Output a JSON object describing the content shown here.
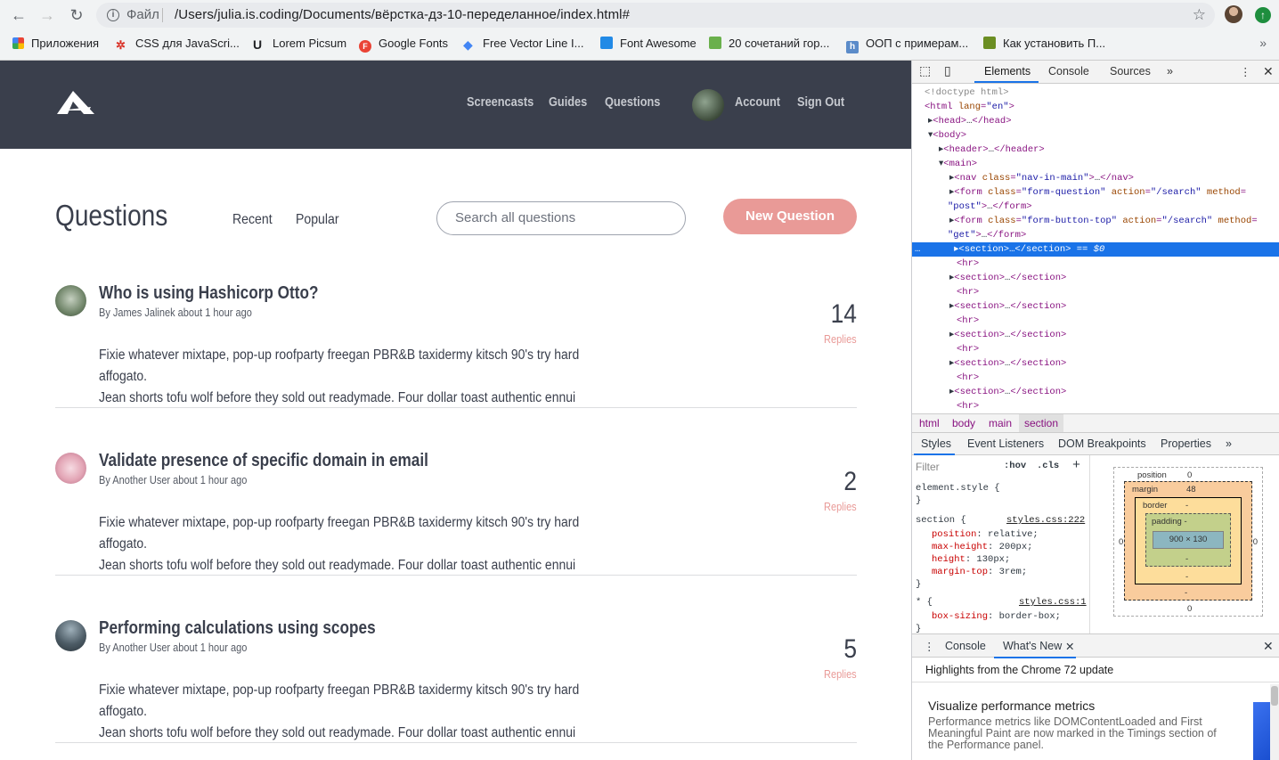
{
  "browser": {
    "file_label": "Файл",
    "url": "/Users/julia.is.coding/Documents/вёрстка-дз-10-переделанное/index.html#",
    "bookmarks": [
      {
        "label": "Приложения"
      },
      {
        "label": "CSS для JavaScri..."
      },
      {
        "label": "Lorem Picsum"
      },
      {
        "label": "Google Fonts"
      },
      {
        "label": "Free Vector Line I..."
      },
      {
        "label": "Font Awesome"
      },
      {
        "label": "20 сочетаний гор..."
      },
      {
        "label": "ООП с примерам..."
      },
      {
        "label": "Как установить П..."
      }
    ]
  },
  "site": {
    "nav": [
      "Screencasts",
      "Guides",
      "Questions"
    ],
    "account": "Account",
    "signout": "Sign Out",
    "heading": "Questions",
    "tabs": [
      "Recent",
      "Popular"
    ],
    "search_placeholder": "Search all questions",
    "new_question": "New Question",
    "questions": [
      {
        "title": "Who is using Hashicorp Otto?",
        "meta": "By James Jalinek about 1 hour ago",
        "count": "14",
        "replies": "Replies",
        "body1": "Fixie whatever mixtape, pop-up roofparty freegan PBR&B taxidermy kitsch 90's try hard affogato.",
        "body2": "Jean shorts tofu wolf before they sold out readymade. Four dollar toast authentic ennui"
      },
      {
        "title": "Validate presence of specific domain in email",
        "meta": "By Another User about 1 hour ago",
        "count": "2",
        "replies": "Replies",
        "body1": "Fixie whatever mixtape, pop-up roofparty freegan PBR&B taxidermy kitsch 90's try hard affogato.",
        "body2": "Jean shorts tofu wolf before they sold out readymade. Four dollar toast authentic ennui"
      },
      {
        "title": "Performing calculations using scopes",
        "meta": "By Another User about 1 hour ago",
        "count": "5",
        "replies": "Replies",
        "body1": "Fixie whatever mixtape, pop-up roofparty freegan PBR&B taxidermy kitsch 90's try hard affogato.",
        "body2": "Jean shorts tofu wolf before they sold out readymade. Four dollar toast authentic ennui"
      }
    ]
  },
  "devtools": {
    "tabs": [
      "Elements",
      "Console",
      "Sources"
    ],
    "crumbs": [
      "html",
      "body",
      "main",
      "section"
    ],
    "subtabs": [
      "Styles",
      "Event Listeners",
      "DOM Breakpoints",
      "Properties"
    ],
    "filter": "Filter",
    "hov": ":hov",
    "cls": ".cls",
    "rule1_link": "styles.css:222",
    "rule2_link": "styles.css:1",
    "box": {
      "position": "position",
      "pos_val": "0",
      "margin": "margin",
      "margin_val": "48",
      "border": "border",
      "dash": "-",
      "padding": "padding -",
      "content": "900 × 130",
      "zero": "0"
    },
    "drawer_tabs": [
      "Console",
      "What's New"
    ],
    "whatsnew_sub": "Highlights from the Chrome 72 update",
    "whatsnew_title": "Visualize performance metrics",
    "whatsnew_text": "Performance metrics like DOMContentLoaded and First Meaningful Paint are now marked in the Timings section of the Performance panel."
  }
}
